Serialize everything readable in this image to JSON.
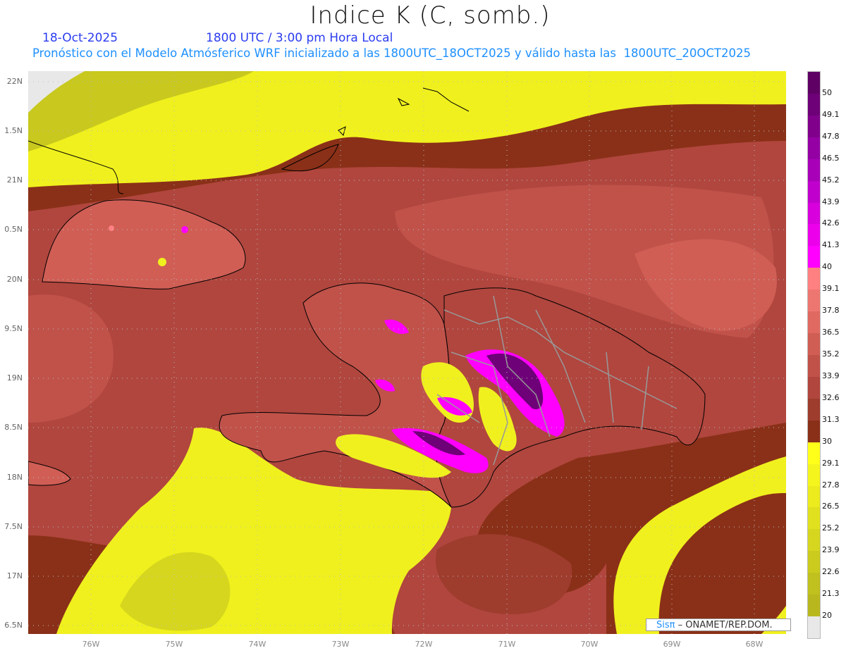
{
  "header": {
    "title": "Indice K (C, somb.)",
    "date": "18-Oct-2025",
    "time": "1800 UTC / 3:00 pm Hora Local",
    "subtitle": "Pronóstico con el Modelo Atmósferico WRF inicializado a las 1800UTC_18OCT2025 y válido hasta las  1800UTC_20OCT2025"
  },
  "axes": {
    "lat_labels": [
      "22N",
      "1.5N",
      "21N",
      "0.5N",
      "20N",
      "9.5N",
      "19N",
      "8.5N",
      "18N",
      "7.5N",
      "17N",
      "6.5N"
    ],
    "lon_labels": [
      "76W",
      "75W",
      "74W",
      "73W",
      "72W",
      "71W",
      "70W",
      "69W",
      "68W"
    ]
  },
  "colorbar": {
    "labels": [
      "50",
      "49.1",
      "47.8",
      "46.5",
      "45.2",
      "43.9",
      "42.6",
      "41.3",
      "40",
      "39.1",
      "37.8",
      "36.5",
      "35.2",
      "33.9",
      "32.6",
      "31.3",
      "30",
      "29.1",
      "27.8",
      "26.5",
      "25.2",
      "23.9",
      "22.6",
      "21.3",
      "20"
    ],
    "colors": [
      "#5e0064",
      "#6e0078",
      "#80008c",
      "#9400a4",
      "#a800b8",
      "#c000cc",
      "#d800dc",
      "#ec00ec",
      "#ff00ff",
      "#ff8080",
      "#ee7670",
      "#e06a62",
      "#d05e55",
      "#c0524a",
      "#b0463e",
      "#9e3c2e",
      "#8a3018",
      "#ffff1a",
      "#f5f51e",
      "#ebeb1e",
      "#e0e01e",
      "#d6d61e",
      "#cbcb1e",
      "#c0c01e",
      "#b8b81e",
      "#e8e8e8"
    ]
  },
  "credit": {
    "brand": "Sisπ",
    "sep": " – ",
    "org": "ONAMET/REP.DOM."
  }
}
